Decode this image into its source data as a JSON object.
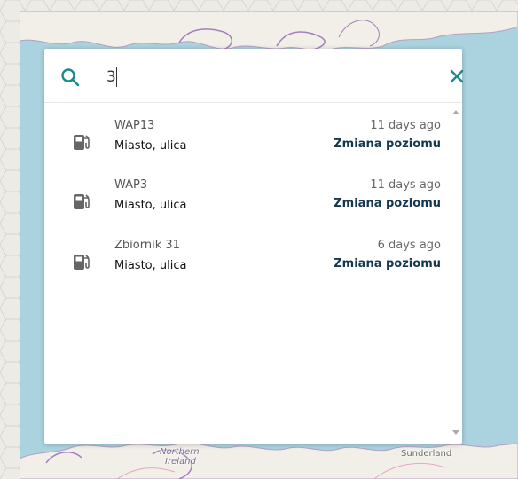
{
  "search": {
    "value": "3",
    "icon": "search-icon",
    "close_icon": "close-icon"
  },
  "results": [
    {
      "name": "WAP13",
      "address": "Miasto, ulica",
      "time": "11 days ago",
      "event": "Zmiana poziomu",
      "icon": "fuel-pump-icon"
    },
    {
      "name": "WAP3",
      "address": "Miasto, ulica",
      "time": "11 days ago",
      "event": "Zmiana poziomu",
      "icon": "fuel-pump-icon"
    },
    {
      "name": "Zbiornik 31",
      "address": "Miasto, ulica",
      "time": "6 days ago",
      "event": "Zmiana poziomu",
      "icon": "fuel-pump-icon"
    }
  ],
  "map": {
    "labels": {
      "northern_ireland_line1": "Northern",
      "northern_ireland_line2": "Ireland",
      "sunderland": "Sunderland"
    }
  },
  "colors": {
    "accent": "#1a8a8a",
    "sea": "#aad3df",
    "land": "#f2efe9",
    "event_text": "#15384f"
  }
}
